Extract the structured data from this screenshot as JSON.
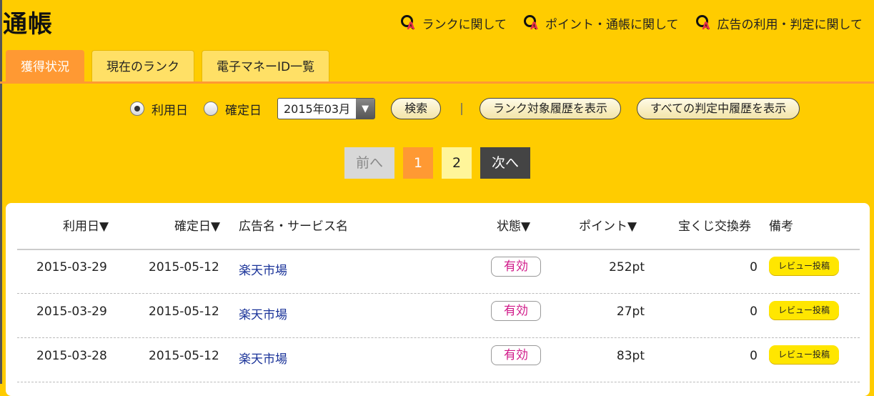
{
  "page": {
    "title": "通帳",
    "qa_links": [
      {
        "label": "ランクに関して",
        "icon": "qa-icon"
      },
      {
        "label": "ポイント・通帳に関して",
        "icon": "qa-icon"
      },
      {
        "label": "広告の利用・判定に関して",
        "icon": "qa-icon"
      }
    ]
  },
  "tabs": [
    {
      "label": "獲得状況",
      "active": true
    },
    {
      "label": "現在のランク",
      "active": false
    },
    {
      "label": "電子マネーID一覧",
      "active": false
    }
  ],
  "filters": {
    "radio_usage_date": "利用日",
    "radio_confirm_date": "確定日",
    "selected_radio": "利用日",
    "month_select": "2015年03月",
    "search_button": "検索",
    "separator": "|",
    "rank_history_button": "ランク対象履歴を表示",
    "all_pending_button": "すべての判定中履歴を表示"
  },
  "pager": {
    "prev": "前へ",
    "pages": [
      "1",
      "2"
    ],
    "current": "1",
    "next": "次へ"
  },
  "table": {
    "headers": {
      "usage_date": "利用日▼",
      "confirm_date": "確定日▼",
      "ad_name": "広告名・サービス名",
      "status": "状態▼",
      "points": "ポイント▼",
      "lottery": "宝くじ交換券",
      "note": "備考"
    },
    "rows": [
      {
        "usage_date": "2015-03-29",
        "confirm_date": "2015-05-12",
        "ad_name": "楽天市場",
        "status": "有効",
        "points": "252pt",
        "lottery": "0",
        "note": "レビュー投稿"
      },
      {
        "usage_date": "2015-03-29",
        "confirm_date": "2015-05-12",
        "ad_name": "楽天市場",
        "status": "有効",
        "points": "27pt",
        "lottery": "0",
        "note": "レビュー投稿"
      },
      {
        "usage_date": "2015-03-28",
        "confirm_date": "2015-05-12",
        "ad_name": "楽天市場",
        "status": "有効",
        "points": "83pt",
        "lottery": "0",
        "note": "レビュー投稿"
      }
    ]
  },
  "colors": {
    "background": "#ffcc00",
    "accent": "#ff9933",
    "status_text": "#d01888",
    "link": "#1a3399",
    "review_badge": "#ffe600"
  }
}
